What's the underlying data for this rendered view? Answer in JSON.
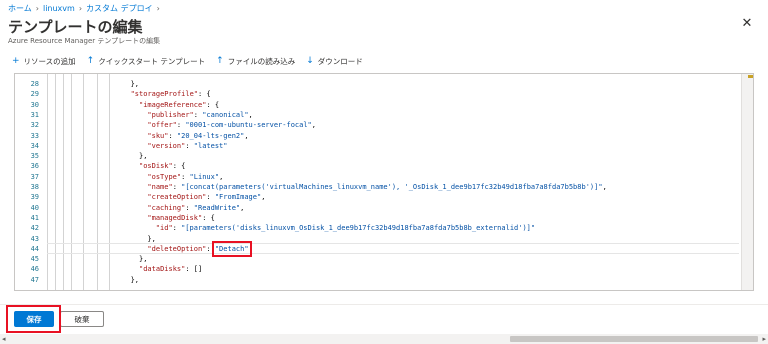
{
  "breadcrumb": [
    "ホーム",
    "linuxvm",
    "カスタム デプロイ"
  ],
  "title": "テンプレートの編集",
  "subtitle": "Azure Resource Manager テンプレートの編集",
  "toolbar": {
    "add_resource": "リソースの追加",
    "quickstart_template": "クイックスタート テンプレート",
    "load_file": "ファイルの読み込み",
    "download": "ダウンロード"
  },
  "editor": {
    "lines": [
      {
        "num": "28",
        "indent": 8,
        "tokens": [
          {
            "t": "},",
            "c": "punc"
          }
        ]
      },
      {
        "num": "29",
        "indent": 8,
        "tokens": [
          {
            "t": "\"storageProfile\"",
            "c": "key"
          },
          {
            "t": ": {",
            "c": "punc"
          }
        ]
      },
      {
        "num": "30",
        "indent": 10,
        "tokens": [
          {
            "t": "\"imageReference\"",
            "c": "key"
          },
          {
            "t": ": {",
            "c": "punc"
          }
        ]
      },
      {
        "num": "31",
        "indent": 12,
        "tokens": [
          {
            "t": "\"publisher\"",
            "c": "key"
          },
          {
            "t": ": ",
            "c": "punc"
          },
          {
            "t": "\"canonical\"",
            "c": "str"
          },
          {
            "t": ",",
            "c": "punc"
          }
        ]
      },
      {
        "num": "32",
        "indent": 12,
        "tokens": [
          {
            "t": "\"offer\"",
            "c": "key"
          },
          {
            "t": ": ",
            "c": "punc"
          },
          {
            "t": "\"0001-com-ubuntu-server-focal\"",
            "c": "str"
          },
          {
            "t": ",",
            "c": "punc"
          }
        ]
      },
      {
        "num": "33",
        "indent": 12,
        "tokens": [
          {
            "t": "\"sku\"",
            "c": "key"
          },
          {
            "t": ": ",
            "c": "punc"
          },
          {
            "t": "\"20_04-lts-gen2\"",
            "c": "str"
          },
          {
            "t": ",",
            "c": "punc"
          }
        ]
      },
      {
        "num": "34",
        "indent": 12,
        "tokens": [
          {
            "t": "\"version\"",
            "c": "key"
          },
          {
            "t": ": ",
            "c": "punc"
          },
          {
            "t": "\"latest\"",
            "c": "str"
          }
        ]
      },
      {
        "num": "35",
        "indent": 10,
        "tokens": [
          {
            "t": "},",
            "c": "punc"
          }
        ]
      },
      {
        "num": "36",
        "indent": 10,
        "tokens": [
          {
            "t": "\"osDisk\"",
            "c": "key"
          },
          {
            "t": ": {",
            "c": "punc"
          }
        ]
      },
      {
        "num": "37",
        "indent": 12,
        "tokens": [
          {
            "t": "\"osType\"",
            "c": "key"
          },
          {
            "t": ": ",
            "c": "punc"
          },
          {
            "t": "\"Linux\"",
            "c": "str"
          },
          {
            "t": ",",
            "c": "punc"
          }
        ]
      },
      {
        "num": "38",
        "indent": 12,
        "tokens": [
          {
            "t": "\"name\"",
            "c": "key"
          },
          {
            "t": ": ",
            "c": "punc"
          },
          {
            "t": "\"[concat(parameters('virtualMachines_linuxvm_name'), '_OsDisk_1_dee9b17fc32b49d18fba7a8fda7b5b8b')]\"",
            "c": "str"
          },
          {
            "t": ",",
            "c": "punc"
          }
        ]
      },
      {
        "num": "39",
        "indent": 12,
        "tokens": [
          {
            "t": "\"createOption\"",
            "c": "key"
          },
          {
            "t": ": ",
            "c": "punc"
          },
          {
            "t": "\"FromImage\"",
            "c": "str"
          },
          {
            "t": ",",
            "c": "punc"
          }
        ]
      },
      {
        "num": "40",
        "indent": 12,
        "tokens": [
          {
            "t": "\"caching\"",
            "c": "key"
          },
          {
            "t": ": ",
            "c": "punc"
          },
          {
            "t": "\"ReadWrite\"",
            "c": "str"
          },
          {
            "t": ",",
            "c": "punc"
          }
        ]
      },
      {
        "num": "41",
        "indent": 12,
        "tokens": [
          {
            "t": "\"managedDisk\"",
            "c": "key"
          },
          {
            "t": ": {",
            "c": "punc"
          }
        ]
      },
      {
        "num": "42",
        "indent": 14,
        "tokens": [
          {
            "t": "\"id\"",
            "c": "key"
          },
          {
            "t": ": ",
            "c": "punc"
          },
          {
            "t": "\"[parameters('disks_linuxvm_OsDisk_1_dee9b17fc32b49d18fba7a8fda7b5b8b_externalid')]\"",
            "c": "str"
          }
        ]
      },
      {
        "num": "43",
        "indent": 12,
        "tokens": [
          {
            "t": "},",
            "c": "punc"
          }
        ]
      },
      {
        "num": "44",
        "indent": 12,
        "tokens": [
          {
            "t": "\"deleteOption\"",
            "c": "key"
          },
          {
            "t": ": ",
            "c": "punc"
          },
          {
            "t": "\"Detach\"",
            "c": "str"
          }
        ]
      },
      {
        "num": "45",
        "indent": 10,
        "tokens": [
          {
            "t": "},",
            "c": "punc"
          }
        ]
      },
      {
        "num": "46",
        "indent": 10,
        "tokens": [
          {
            "t": "\"dataDisks\"",
            "c": "key"
          },
          {
            "t": ": []",
            "c": "punc"
          }
        ]
      },
      {
        "num": "47",
        "indent": 8,
        "tokens": [
          {
            "t": "},",
            "c": "punc"
          }
        ]
      }
    ]
  },
  "footer": {
    "save_label": "保存",
    "discard_label": "破棄"
  },
  "colors": {
    "accent": "#0078d4",
    "highlight_box": "#e81123",
    "json_key": "#a31515",
    "json_string": "#0451a5",
    "line_number": "#237893"
  },
  "icons": {
    "add": "plus-icon",
    "quickstart": "upload-arrow-icon",
    "load_file": "upload-arrow-icon",
    "download": "download-arrow-icon",
    "close": "close-icon",
    "more": "ellipsis-icon"
  }
}
